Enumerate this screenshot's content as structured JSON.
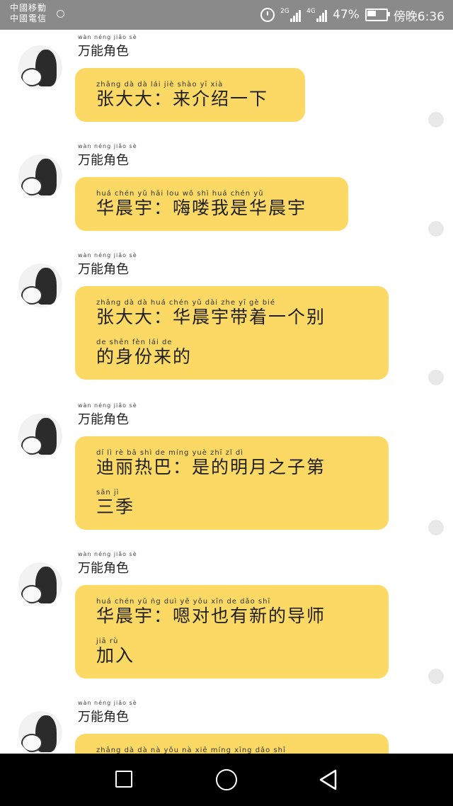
{
  "status_bar": {
    "carrier_lines": [
      "中國移動",
      "中國電信"
    ],
    "network_1": "2G",
    "network_2": "4G",
    "battery": "47%",
    "time": "傍晚6:36"
  },
  "messages": [
    {
      "name": "万能角色",
      "name_pinyin": "wàn néng jiǎo sè",
      "lines": [
        {
          "pinyin": "zhāng dà dà     lái jiè shào yī xià",
          "text": "张大大：来介绍一下"
        }
      ]
    },
    {
      "name": "万能角色",
      "name_pinyin": "wàn néng jiǎo sè",
      "lines": [
        {
          "pinyin": "huá chén yǔ     hāi lou wǒ shì huá chén yǔ",
          "text": "华晨宇：嗨喽我是华晨宇"
        }
      ]
    },
    {
      "name": "万能角色",
      "name_pinyin": "wàn néng jiǎo sè",
      "lines": [
        {
          "pinyin": "zhāng dà dà     huá chén yǔ dài zhe yī gè bié",
          "text": "张大大：华晨宇带着一个别"
        },
        {
          "pinyin": "de shēn fèn lái de",
          "text": "的身份来的"
        }
      ]
    },
    {
      "name": "万能角色",
      "name_pinyin": "wàn néng jiǎo sè",
      "lines": [
        {
          "pinyin": "dí lì rè bā     shì de míng yuè zhī zǐ dì",
          "text": "迪丽热巴：是的明月之子第"
        },
        {
          "pinyin": "sān jì",
          "text": "三季"
        }
      ]
    },
    {
      "name": "万能角色",
      "name_pinyin": "wàn néng jiǎo sè",
      "lines": [
        {
          "pinyin": "huá chén yǔ     ǹg duì yě yǒu xīn de dǎo shī",
          "text": "华晨宇：嗯对也有新的导师"
        },
        {
          "pinyin": "jiā rù",
          "text": "加入"
        }
      ]
    },
    {
      "name": "万能角色",
      "name_pinyin": "wàn néng jiǎo sè",
      "lines": [
        {
          "pinyin": "zhāng dà dà     nà yǒu nà xiē míng xīng dǎo shī",
          "text": ""
        }
      ]
    }
  ],
  "colors": {
    "bubble": "#fcd964",
    "status_bar": "#8a8a8a",
    "nav_bar": "#000000"
  },
  "nav_bar": {
    "icons": [
      "square-recent-apps-icon",
      "circle-home-icon",
      "triangle-back-icon"
    ]
  }
}
